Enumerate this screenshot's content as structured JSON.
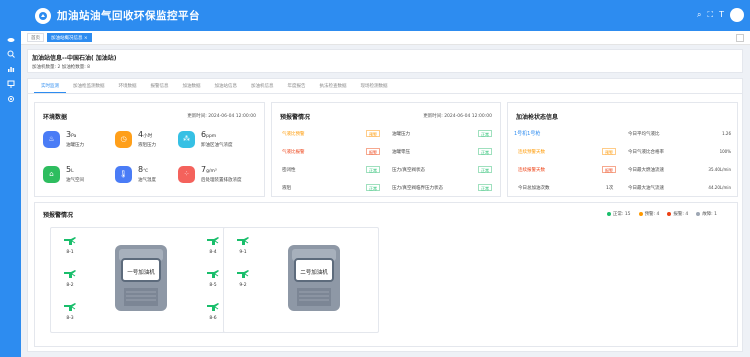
{
  "app": {
    "title": "加油站油气回收环保监控平台"
  },
  "page_tabs": [
    {
      "label": "首页",
      "active": false
    },
    {
      "label": "加油站概况信息 ×",
      "active": true
    }
  ],
  "station": {
    "title": "加油站信息--中国石油(          加油站)",
    "counts": "加油机数量: 2  加油枪数量: 8"
  },
  "module_tabs": [
    "实时监测",
    "加油枪监测数据",
    "环境数据",
    "报警信息",
    "加油数据",
    "加油站信息",
    "加油机信息",
    "年度报告",
    "执法检查数据",
    "现场检测数据"
  ],
  "env": {
    "title": "环境数据",
    "time": "更新时间: 2024-06-04 12:00:00",
    "items": [
      {
        "value": "3",
        "unit": "Pa",
        "label": "油罐压力",
        "color": "#4a7cf6",
        "icon": "flame-icon"
      },
      {
        "value": "4",
        "unit": "小时",
        "label": "液阻压力",
        "color": "#ff9f1a",
        "icon": "clock-icon"
      },
      {
        "value": "6",
        "unit": "ppm",
        "label": "卸油区油气浓度",
        "color": "#36c0e4",
        "icon": "bubbles-icon"
      },
      {
        "value": "5",
        "unit": "L",
        "label": "油气空间",
        "color": "#2ebd5f",
        "icon": "tank-icon"
      },
      {
        "value": "8",
        "unit": "℃",
        "label": "油气温度",
        "color": "#4a7cf6",
        "icon": "thermometer-icon"
      },
      {
        "value": "7",
        "unit": "g/m³",
        "label": "后处理装置排放浓度",
        "color": "#f4625c",
        "icon": "particles-icon"
      }
    ]
  },
  "alarm": {
    "title": "预报警情况",
    "time": "更新时间: 2024-06-04 12:00:00",
    "rows": [
      {
        "label": "气液比预警",
        "status": "预警",
        "kind": "warn",
        "label_color": "#ff9900"
      },
      {
        "label": "油罐压力",
        "status": "正常",
        "kind": "ok",
        "label_color": "#444"
      },
      {
        "label": "气液比报警",
        "status": "报警",
        "kind": "alarm",
        "label_color": "#ed4014"
      },
      {
        "label": "油罐零压",
        "status": "正常",
        "kind": "ok",
        "label_color": "#444"
      },
      {
        "label": "密闭性",
        "status": "正常",
        "kind": "ok",
        "label_color": "#444"
      },
      {
        "label": "压力/真空阀状态",
        "status": "正常",
        "kind": "ok",
        "label_color": "#444"
      },
      {
        "label": "液阻",
        "status": "正常",
        "kind": "ok",
        "label_color": "#444"
      },
      {
        "label": "压力/真空阀临界压力状态",
        "status": "正常",
        "kind": "ok",
        "label_color": "#444"
      }
    ]
  },
  "gun": {
    "title": "加油枪状态信息",
    "tab": "1号机1号枪",
    "left_rows": [
      {
        "label": "连续预警天数",
        "status": "预警",
        "kind": "warn"
      },
      {
        "label": "连续报警天数",
        "status": "报警",
        "kind": "alarm"
      },
      {
        "label": "今日总加油次数",
        "status": "1次",
        "kind": "plain"
      }
    ],
    "right_rows": [
      {
        "label": "今日平均气液比",
        "value": "1.26"
      },
      {
        "label": "今日气液比合格率",
        "value": "100%"
      },
      {
        "label": "今日最大燃油流速",
        "value": "35.40L/min"
      },
      {
        "label": "今日最大油气流速",
        "value": "44.20L/min"
      }
    ]
  },
  "alert_section": {
    "title": "预报警情况",
    "legend": [
      {
        "label": "正常: 15",
        "color": "#19be6b"
      },
      {
        "label": "预警: 4",
        "color": "#ff9900"
      },
      {
        "label": "报警: 4",
        "color": "#ed4014"
      },
      {
        "label": "故障: 1",
        "color": "#9ea7b4"
      }
    ]
  },
  "dispensers": [
    {
      "name": "一号加油机",
      "left": [
        "8-1",
        "8-2",
        "8-3"
      ],
      "right": [
        "8-4",
        "8-5",
        "8-6"
      ]
    },
    {
      "name": "二号加油机",
      "left": [
        "9-1",
        "9-2"
      ],
      "right": []
    }
  ]
}
